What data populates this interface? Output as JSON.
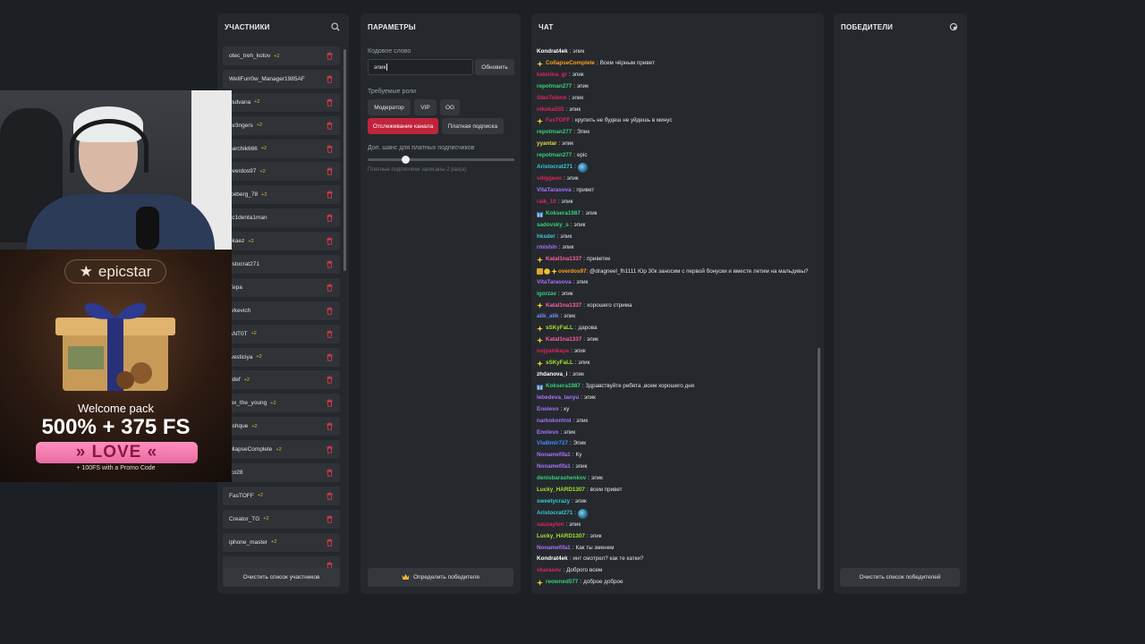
{
  "participants": {
    "title": "УЧАСТНИКИ",
    "items": [
      {
        "name": "otec_treh_kotov",
        "badge": "+2"
      },
      {
        "name": "WellFurr0w_Manager1985AF",
        "badge": ""
      },
      {
        "name": "ksdvana",
        "badge": "+2"
      },
      {
        "name": "av3ngers",
        "badge": "+2"
      },
      {
        "name": "earchik666",
        "badge": "+2"
      },
      {
        "name": "overdos97",
        "badge": "+2"
      },
      {
        "name": "iceberg_78",
        "badge": "+2"
      },
      {
        "name": "cc1denta1man",
        "badge": ""
      },
      {
        "name": "ekaez",
        "badge": "+2"
      },
      {
        "name": "ristocrat271",
        "badge": ""
      },
      {
        "name": "Zepa",
        "badge": ""
      },
      {
        "name": "arkevich",
        "badge": ""
      },
      {
        "name": "ANT0T",
        "badge": "+2"
      },
      {
        "name": "westiciya",
        "badge": "+2"
      },
      {
        "name": "ddef",
        "badge": "+2"
      },
      {
        "name": "lex_the_young",
        "badge": "+2"
      },
      {
        "name": "ashque",
        "badge": "+2"
      },
      {
        "name": "ollapseComplete",
        "badge": "+2"
      },
      {
        "name": "ico28",
        "badge": ""
      },
      {
        "name": "FasTOFF",
        "badge": "+2"
      },
      {
        "name": "Creator_TG",
        "badge": "+2"
      },
      {
        "name": "iphone_master",
        "badge": "+2"
      },
      {
        "name": "",
        "badge": ""
      }
    ],
    "clear_button": "Очистить список участников"
  },
  "settings": {
    "title": "ПАРАМЕТРЫ",
    "codeword_label": "Кодовое слово",
    "codeword_value": "эпик",
    "update_button": "Обновить",
    "roles_label": "Требуемые роли",
    "roles": [
      "Модератор",
      "VIP",
      "OG"
    ],
    "follow_button": "Отслеживание канала",
    "sub_button": "Платная подписка",
    "chance_label": "Доп. шанс для платных подписчиков",
    "chance_value": 0.26,
    "chance_hint": "Платные подписчики записаны 2 раз(а)",
    "winner_button": "Определить победителя"
  },
  "chat": {
    "title": "ЧАТ",
    "messages": [
      {
        "user": "Kondrat4ek",
        "color": "#ffffff",
        "text": "эпик",
        "badge": ""
      },
      {
        "user": "CollapseComplete",
        "color": "#ff9f1a",
        "text": "Всем чёрным привет",
        "badge": "star"
      },
      {
        "user": "katerina_gr",
        "color": "#e0245e",
        "text": "эпик",
        "badge": ""
      },
      {
        "user": "repotman277",
        "color": "#33d17a",
        "text": "эпик",
        "badge": ""
      },
      {
        "user": "StasTulenn",
        "color": "#e0245e",
        "text": "эпик",
        "badge": ""
      },
      {
        "user": "nikoka555",
        "color": "#e0245e",
        "text": "эпик",
        "badge": ""
      },
      {
        "user": "FasTOFF",
        "color": "#e0245e",
        "text": "крупить не будеш не уйдешь в минус",
        "badge": "star"
      },
      {
        "user": "repotman277",
        "color": "#33d17a",
        "text": "Эпик",
        "badge": ""
      },
      {
        "user": "yyantar",
        "color": "#e8d44d",
        "text": "эпик",
        "badge": ""
      },
      {
        "user": "repotman277",
        "color": "#33d17a",
        "text": "epic",
        "badge": ""
      },
      {
        "user": "Aristocrat271",
        "color": "#36c9d8",
        "text": "",
        "badge": "",
        "emote": true
      },
      {
        "user": "vdiggeon",
        "color": "#e0245e",
        "text": "эпик",
        "badge": ""
      },
      {
        "user": "VitaTarasova",
        "color": "#a970ff",
        "text": "привет",
        "badge": ""
      },
      {
        "user": "raik_10",
        "color": "#e0245e",
        "text": "эпик",
        "badge": ""
      },
      {
        "user": "Koksera1987",
        "color": "#33d17a",
        "text": "эпик",
        "badge": "gift"
      },
      {
        "user": "sadovsky_s",
        "color": "#33d17a",
        "text": "эпик",
        "badge": ""
      },
      {
        "user": "hksder",
        "color": "#36c9d8",
        "text": "эпик",
        "badge": ""
      },
      {
        "user": "rmishin",
        "color": "#a970ff",
        "text": "эпик",
        "badge": ""
      },
      {
        "user": "Katal1na1337",
        "color": "#ff5fa2",
        "text": "приветик",
        "badge": "star"
      },
      {
        "user": "overdos97",
        "color": "#ff9f1a",
        "text": "@dragneel_fh1111 Юр 30к заносим с первой бонуски и вместе летим на мальдивы?",
        "badge": "multi",
        "wrap": true
      },
      {
        "user": "VitaTarasova",
        "color": "#a970ff",
        "text": "эпик",
        "badge": ""
      },
      {
        "user": "igorzav",
        "color": "#33d17a",
        "text": "эпик",
        "badge": ""
      },
      {
        "user": "Katal1na1337",
        "color": "#ff5fa2",
        "text": "хорошего стрима",
        "badge": "star"
      },
      {
        "user": "alik_alik",
        "color": "#6f8cff",
        "text": "эпик",
        "badge": ""
      },
      {
        "user": "sSKyFaLL",
        "color": "#a6e22e",
        "text": "дарова",
        "badge": "star"
      },
      {
        "user": "Katal1na1337",
        "color": "#ff5fa2",
        "text": "эпик",
        "badge": "star"
      },
      {
        "user": "nojyamkaya",
        "color": "#e0245e",
        "text": "эпик",
        "badge": ""
      },
      {
        "user": "sSKyFaLL",
        "color": "#a6e22e",
        "text": "эпик",
        "badge": "star"
      },
      {
        "user": "zhdanova_i",
        "color": "#ffffff",
        "text": "эпик",
        "badge": ""
      },
      {
        "user": "Koksera1987",
        "color": "#33d17a",
        "text": "Здравствуйте ребята ,всем хорошего дня",
        "badge": "gift"
      },
      {
        "user": "lebedeva_tanyu",
        "color": "#a970ff",
        "text": "эпик",
        "badge": ""
      },
      {
        "user": "Enolevo",
        "color": "#a970ff",
        "text": "ку",
        "badge": ""
      },
      {
        "user": "narkokontrol",
        "color": "#a970ff",
        "text": "эпик",
        "badge": ""
      },
      {
        "user": "Enolevo",
        "color": "#a970ff",
        "text": "эпик",
        "badge": ""
      },
      {
        "user": "Vla8imir727",
        "color": "#3b8cff",
        "text": "Эпик",
        "badge": ""
      },
      {
        "user": "Nonamefifa1",
        "color": "#a970ff",
        "text": "Ку",
        "badge": ""
      },
      {
        "user": "Nonamefifa1",
        "color": "#a970ff",
        "text": "эпик",
        "badge": ""
      },
      {
        "user": "denisbarashenkov",
        "color": "#33d17a",
        "text": "эпик",
        "badge": ""
      },
      {
        "user": "Lucky_HARD1307",
        "color": "#a6e22e",
        "text": "всем привет",
        "badge": ""
      },
      {
        "user": "sweetycrazy",
        "color": "#36c9d8",
        "text": "эпик",
        "badge": ""
      },
      {
        "user": "Aristocrat271",
        "color": "#36c9d8",
        "text": "",
        "badge": "",
        "emote": true
      },
      {
        "user": "sauzaylon",
        "color": "#e0245e",
        "text": "эпик",
        "badge": ""
      },
      {
        "user": "Lucky_HARD1307",
        "color": "#a6e22e",
        "text": "эпик",
        "badge": ""
      },
      {
        "user": "Nonamefifa1",
        "color": "#a970ff",
        "text": "Как ты зменем",
        "badge": ""
      },
      {
        "user": "Kondrat4ek",
        "color": "#ffffff",
        "text": "инт смотрел? как те катки?",
        "badge": ""
      },
      {
        "user": "vkarasov",
        "color": "#e0245e",
        "text": "Доброго всем",
        "badge": ""
      },
      {
        "user": "reowned577",
        "color": "#33d17a",
        "text": "доброе доброе",
        "badge": "star"
      }
    ]
  },
  "winners": {
    "title": "ПОБЕДИТЕЛИ",
    "clear_button": "Очистить список победителей"
  },
  "ad": {
    "brand": "epicstar",
    "welcome": "Welcome pack",
    "offer": "500% + 375 FS",
    "code": "» LOVE «",
    "footnote": "+ 100FS with a Promo Code"
  },
  "colors": {
    "accent": "#c0243c",
    "delete_icon": "#d9364c",
    "badge": "#e0b341"
  }
}
